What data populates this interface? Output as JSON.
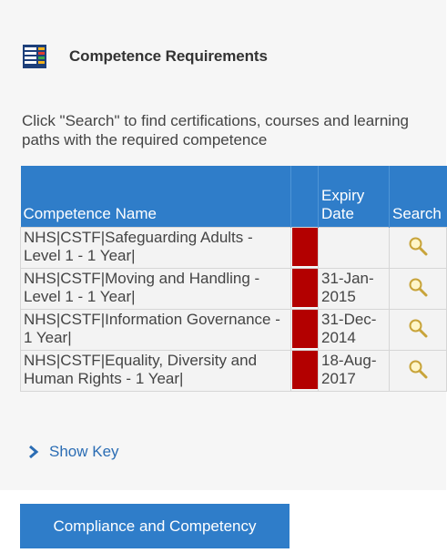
{
  "header": {
    "title": "Competence Requirements",
    "icon": "list-report-icon"
  },
  "intro": {
    "text": "Click \"Search\" to find certifications, courses and learning paths with the required competence"
  },
  "table": {
    "columns": [
      "Competence Name",
      "",
      "Expiry Date",
      "Search"
    ],
    "rows": [
      {
        "name": "NHS|CSTF|Safeguarding Adults - Level 1 - 1 Year|",
        "status_color": "#b30000",
        "expiry": ""
      },
      {
        "name": "NHS|CSTF|Moving and Handling - Level 1 - 1 Year|",
        "status_color": "#b30000",
        "expiry": "31-Jan-2015"
      },
      {
        "name": "NHS|CSTF|Information Governance - 1 Year|",
        "status_color": "#b30000",
        "expiry": "31-Dec-2014"
      },
      {
        "name": "NHS|CSTF|Equality, Diversity and Human Rights - 1 Year|",
        "status_color": "#b30000",
        "expiry": "18-Aug-2017"
      }
    ]
  },
  "show_key": {
    "label": "Show Key",
    "icon": "chevron-right-icon"
  },
  "footer": {
    "button_label": "Compliance and Competency"
  },
  "colors": {
    "accent": "#2f7dc9",
    "status_red": "#b30000",
    "panel_bg": "#f6f6f6"
  }
}
